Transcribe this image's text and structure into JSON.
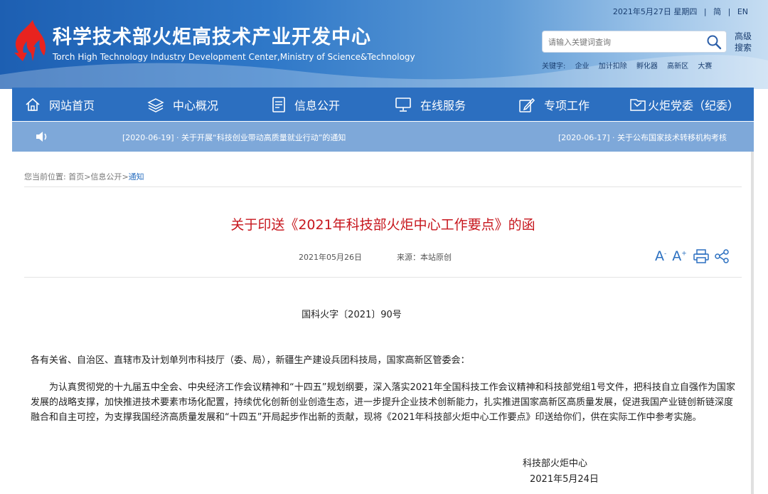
{
  "header": {
    "title": "科学技术部火炬高技术产业开发中心",
    "subtitle": "Torch High Technology Industry Development Center,Ministry of Science&Technology",
    "date": "2021年5月27日 星期四",
    "lang_simplified": "简",
    "lang_en": "EN",
    "search_placeholder": "请输入关键词查询",
    "advanced_search": "高级搜索",
    "keywords_label": "关键字:",
    "keywords": [
      "企业",
      "加计扣除",
      "孵化器",
      "高新区",
      "大赛"
    ]
  },
  "nav": {
    "items": [
      {
        "label": "网站首页",
        "icon": "home-icon"
      },
      {
        "label": "中心概况",
        "icon": "layers-icon"
      },
      {
        "label": "信息公开",
        "icon": "document-icon"
      },
      {
        "label": "在线服务",
        "icon": "monitor-icon"
      },
      {
        "label": "专项工作",
        "icon": "pen-icon"
      },
      {
        "label": "火炬党委（纪委）",
        "icon": "flag-book-icon"
      }
    ]
  },
  "notice": {
    "icon": "speaker-icon",
    "items": [
      "[2020-06-19] · 关于开展“科技创业带动高质量就业行动”的通知",
      "[2020-06-17] · 关于公布国家技术转移机构考核"
    ]
  },
  "breadcrumb": {
    "label": "您当前位置:",
    "home": "首页",
    "sep1": ">",
    "section": "信息公开",
    "sep2": ">",
    "current": "通知"
  },
  "article": {
    "title": "关于印送《2021年科技部火炬中心工作要点》的函",
    "date": "2021年05月26日",
    "source": "来源：本站原创",
    "font_larger": "A",
    "font_smaller": "A",
    "doc_number": "国科火字〔2021〕90号",
    "salutation": "各有关省、自治区、直辖市及计划单列市科技厅（委、局），新疆生产建设兵团科技局，国家高新区管委会：",
    "body": "为认真贯彻党的十九届五中全会、中央经济工作会议精神和“十四五”规划纲要，深入落实2021年全国科技工作会议精神和科技部党组1号文件，把科技自立自强作为国家发展的战略支撑，加快推进技术要素市场化配置，持续优化创新创业创造生态，进一步提升企业技术创新能力，扎实推进国家高新区高质量发展，促进我国产业链创新链深度融合和自主可控，为支撑我国经济高质量发展和“十四五”开局起步作出新的贡献，现将《2021年科技部火炬中心工作要点》印送给你们，供在实际工作中参考实施。",
    "signature": "科技部火炬中心",
    "sign_date": "2021年5月24日"
  },
  "colors": {
    "nav_bg": "#2c6fc0",
    "notice_bg": "#7ea8d9",
    "title_red": "#c7161d",
    "link_blue": "#2a6fc0"
  }
}
